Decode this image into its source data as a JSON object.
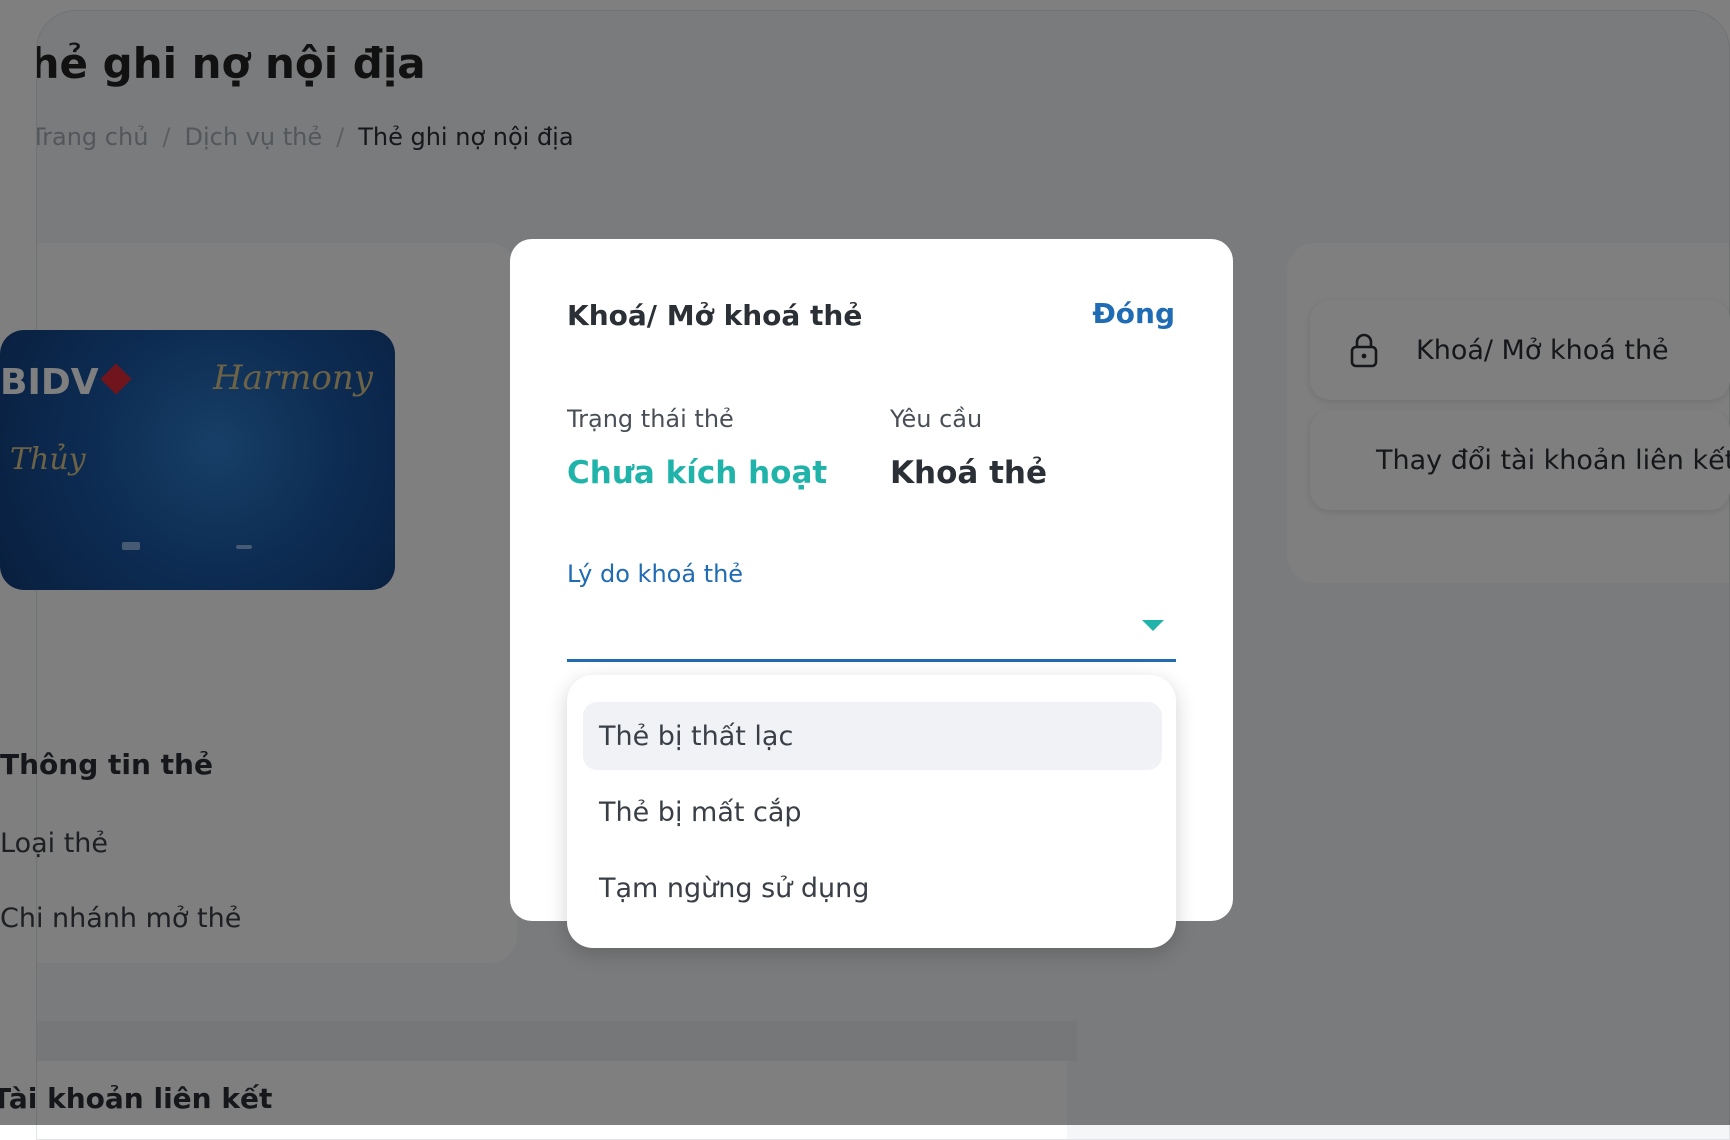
{
  "page": {
    "title": "Thẻ ghi nợ nội địa",
    "breadcrumb": [
      "Trang chủ",
      "Dịch vụ thẻ",
      "Thẻ ghi nợ nội địa"
    ]
  },
  "card": {
    "bank_logo": "BIDV",
    "brand": "Harmony",
    "holder": "Thủy"
  },
  "card_info": {
    "title": "Thông tin thẻ",
    "rows": [
      "Loại thẻ",
      "Chi nhánh mở thẻ"
    ]
  },
  "linked_accounts": {
    "title": "Tài khoản liên kết"
  },
  "actions": [
    {
      "label": "Khoá/ Mở khoá thẻ",
      "icon": "lock-icon"
    },
    {
      "label": "Thay đổi tài khoản liên kết",
      "icon": "link-icon"
    }
  ],
  "modal": {
    "title": "Khoá/ Mở khoá thẻ",
    "close_label": "Đóng",
    "status_label": "Trạng thái thẻ",
    "status_value": "Chưa kích hoạt",
    "request_label": "Yêu cầu",
    "request_value": "Khoá thẻ",
    "reason_label": "Lý do khoá thẻ",
    "reason_value": "",
    "reason_options": [
      "Thẻ bị thất lạc",
      "Thẻ bị mất cắp",
      "Tạm ngừng sử dụng"
    ]
  },
  "colors": {
    "accent": "#1fb3a9",
    "link": "#1f6bb4"
  }
}
